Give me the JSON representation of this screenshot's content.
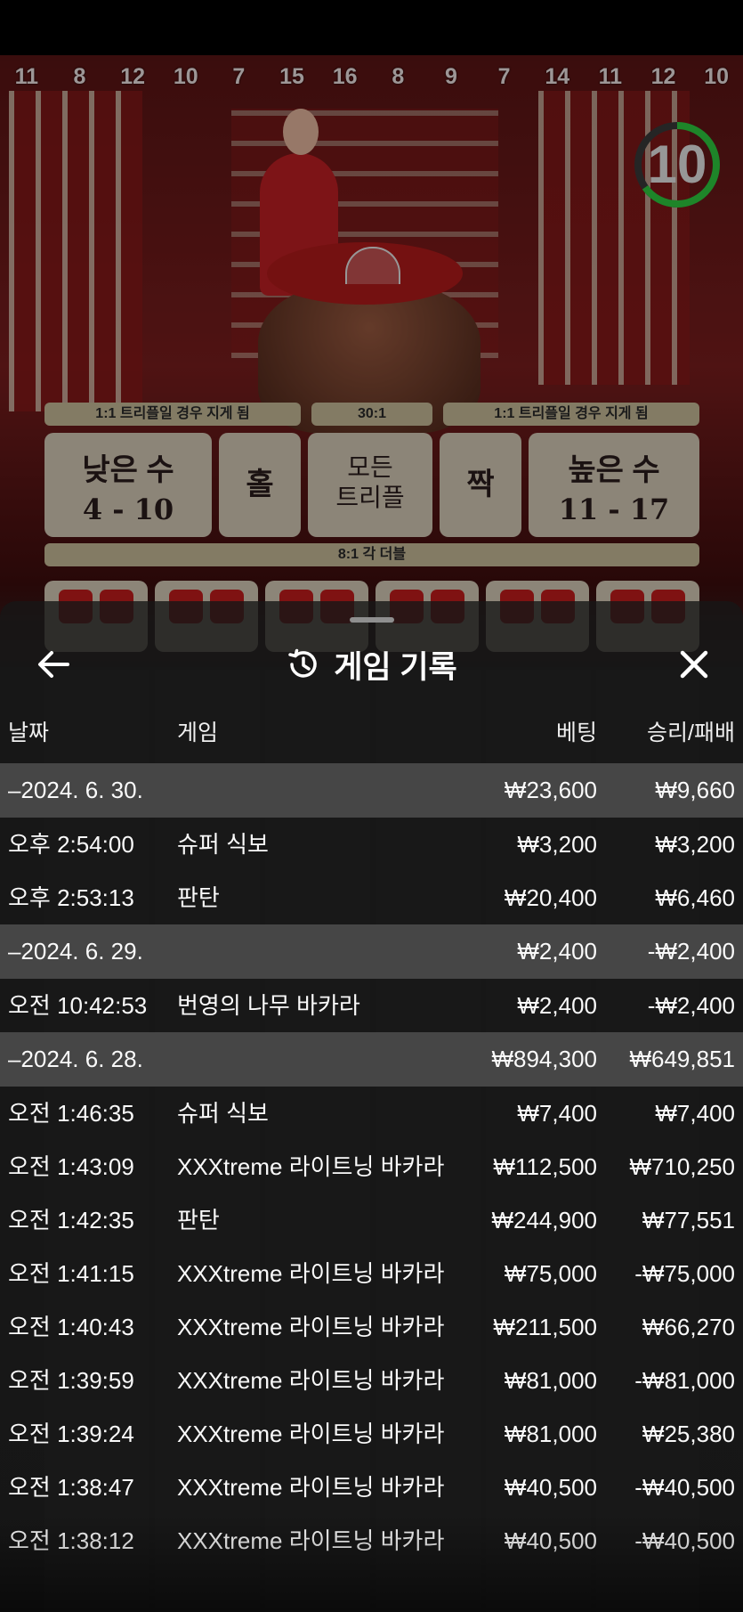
{
  "game_scene": {
    "road_numbers": [
      "11",
      "8",
      "12",
      "10",
      "7",
      "15",
      "16",
      "8",
      "9",
      "7",
      "14",
      "11",
      "12",
      "10"
    ],
    "timer": "10",
    "strip_left": "1:1 트리플일 경우 지게 됨",
    "strip_mid": "30:1",
    "strip_right": "1:1 트리플일 경우 지게 됨",
    "bets": {
      "low_title": "낮은 수",
      "low_range": "4 - 10",
      "odd": "홀",
      "any_triple": "모든\n트리플",
      "even": "짝",
      "high_title": "높은 수",
      "high_range": "11 - 17"
    },
    "double_strip": "8:1 각 더블",
    "colors": {
      "table_red": "#c41c1c",
      "bet_bg": "#d7ccb8",
      "timer_green": "#2ecc40"
    }
  },
  "sheet": {
    "back_icon": "arrow-left-icon",
    "history_icon": "history-clock-icon",
    "title": "게임 기록",
    "close_icon": "close-icon",
    "columns": {
      "date": "날짜",
      "game": "게임",
      "bet": "베팅",
      "result": "승리/패배"
    },
    "rows": [
      {
        "type": "day",
        "date": "–2024. 6. 30.",
        "game": "",
        "bet": "₩23,600",
        "result": "₩9,660"
      },
      {
        "type": "item",
        "date": "오후 2:54:00",
        "game": "슈퍼 식보",
        "bet": "₩3,200",
        "result": "₩3,200"
      },
      {
        "type": "item",
        "date": "오후 2:53:13",
        "game": "판탄",
        "bet": "₩20,400",
        "result": "₩6,460"
      },
      {
        "type": "day",
        "date": "–2024. 6. 29.",
        "game": "",
        "bet": "₩2,400",
        "result": "-₩2,400"
      },
      {
        "type": "item",
        "date": "오전 10:42:53",
        "game": "번영의 나무 바카라",
        "bet": "₩2,400",
        "result": "-₩2,400"
      },
      {
        "type": "day",
        "date": "–2024. 6. 28.",
        "game": "",
        "bet": "₩894,300",
        "result": "₩649,851"
      },
      {
        "type": "item",
        "date": "오전 1:46:35",
        "game": "슈퍼 식보",
        "bet": "₩7,400",
        "result": "₩7,400"
      },
      {
        "type": "item",
        "date": "오전 1:43:09",
        "game": "XXXtreme 라이트닝 바카라",
        "bet": "₩112,500",
        "result": "₩710,250"
      },
      {
        "type": "item",
        "date": "오전 1:42:35",
        "game": "판탄",
        "bet": "₩244,900",
        "result": "₩77,551"
      },
      {
        "type": "item",
        "date": "오전 1:41:15",
        "game": "XXXtreme 라이트닝 바카라",
        "bet": "₩75,000",
        "result": "-₩75,000"
      },
      {
        "type": "item",
        "date": "오전 1:40:43",
        "game": "XXXtreme 라이트닝 바카라",
        "bet": "₩211,500",
        "result": "₩66,270"
      },
      {
        "type": "item",
        "date": "오전 1:39:59",
        "game": "XXXtreme 라이트닝 바카라",
        "bet": "₩81,000",
        "result": "-₩81,000"
      },
      {
        "type": "item",
        "date": "오전 1:39:24",
        "game": "XXXtreme 라이트닝 바카라",
        "bet": "₩81,000",
        "result": "₩25,380"
      },
      {
        "type": "item",
        "date": "오전 1:38:47",
        "game": "XXXtreme 라이트닝 바카라",
        "bet": "₩40,500",
        "result": "-₩40,500"
      },
      {
        "type": "item",
        "date": "오전 1:38:12",
        "game": "XXXtreme 라이트닝 바카라",
        "bet": "₩40,500",
        "result": "-₩40,500"
      }
    ]
  }
}
